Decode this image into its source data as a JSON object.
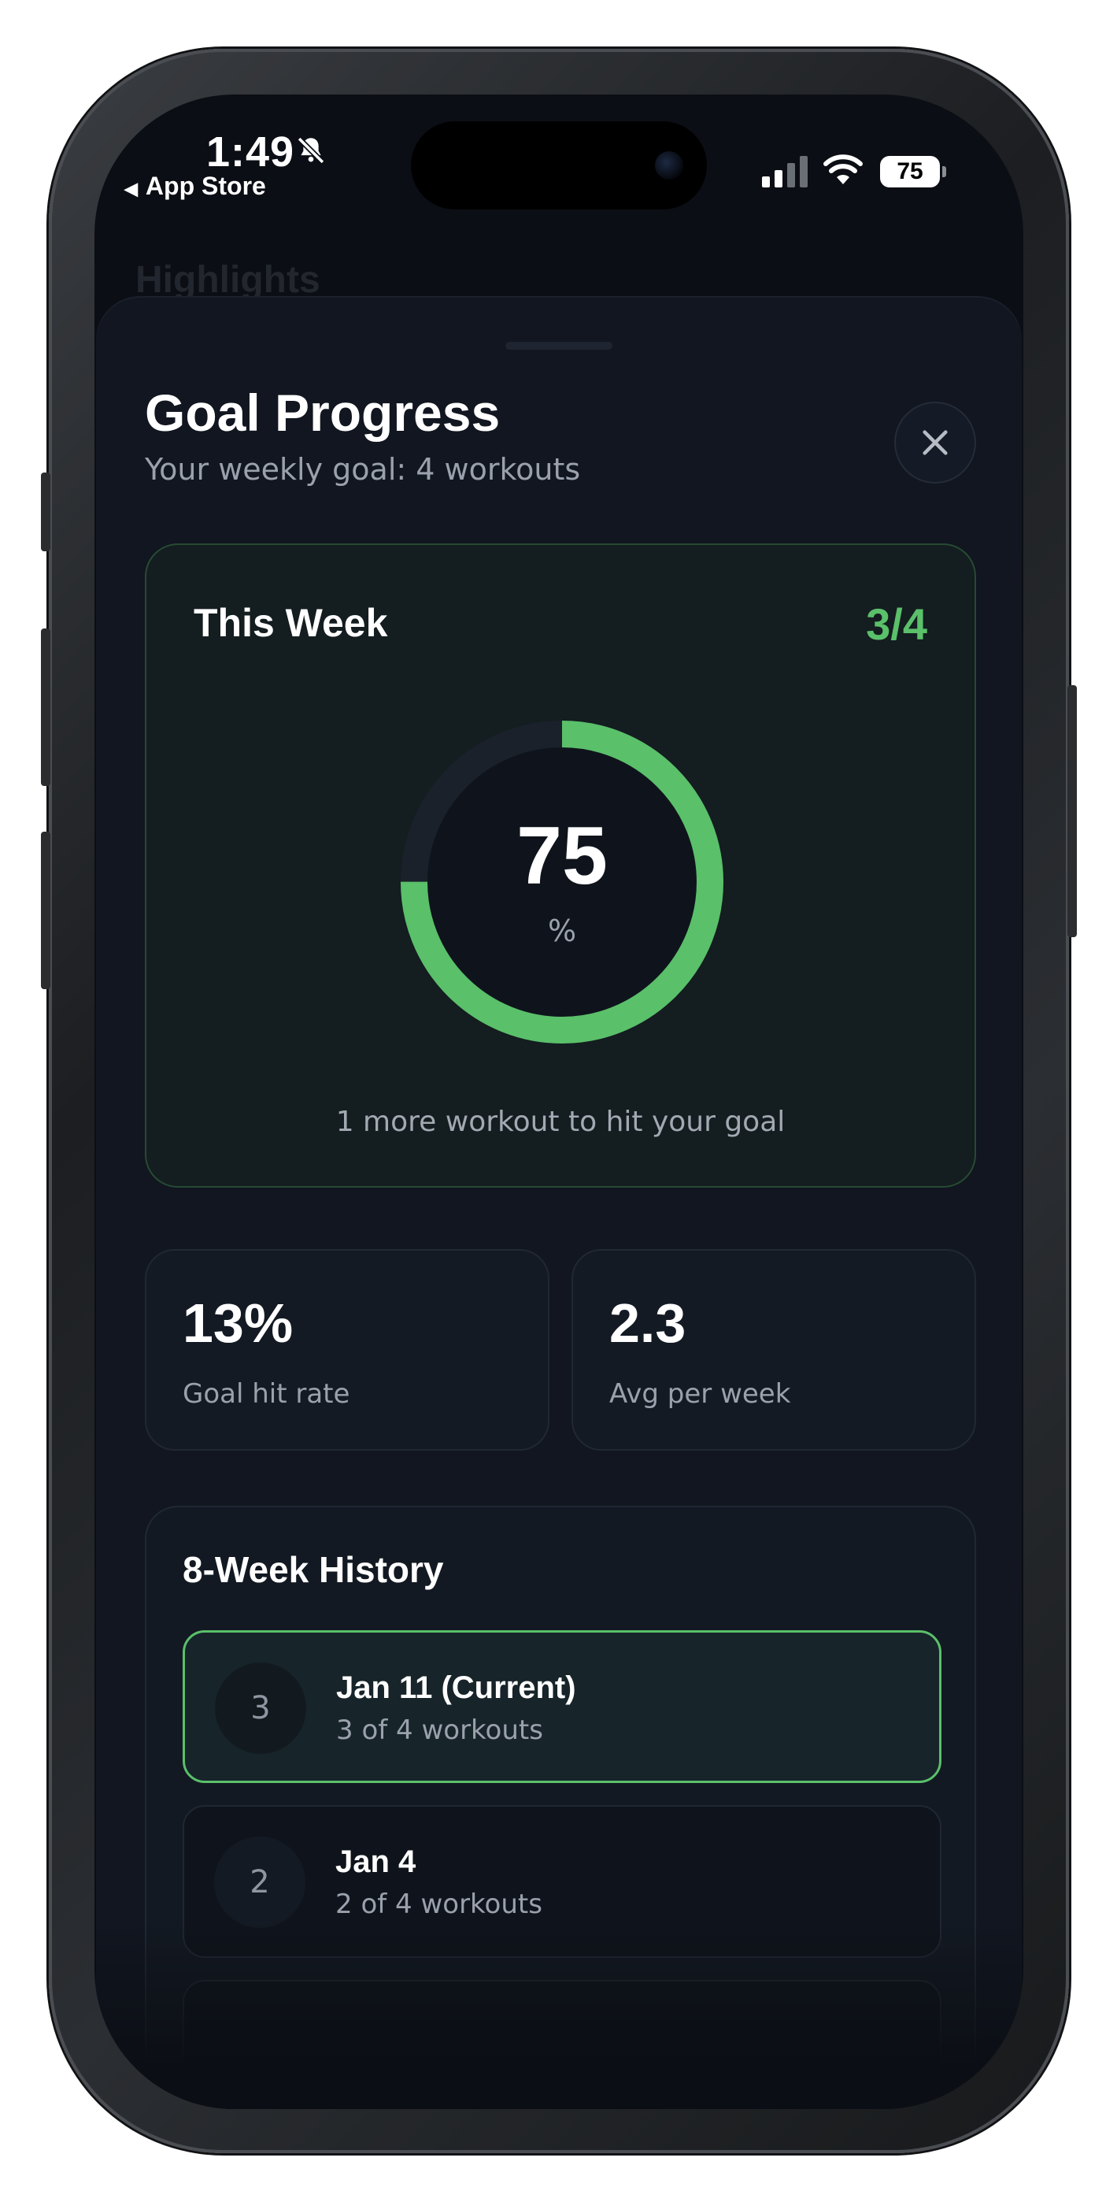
{
  "status_bar": {
    "time": "1:49",
    "back_label": "App Store",
    "battery": "75"
  },
  "background_title": "Highlights",
  "sheet": {
    "title": "Goal Progress",
    "subtitle": "Your weekly goal: 4 workouts"
  },
  "this_week": {
    "label": "This Week",
    "count": "3/4",
    "percent_value": "75",
    "percent_unit": "%",
    "progress": 0.75,
    "hint": "1 more workout to hit your goal"
  },
  "stats": [
    {
      "value": "13%",
      "label": "Goal hit rate"
    },
    {
      "value": "2.3",
      "label": "Avg per week"
    }
  ],
  "history": {
    "title": "8-Week History",
    "rows": [
      {
        "badge": "3",
        "title": "Jan 11 (Current)",
        "subtitle": "3 of 4 workouts",
        "current": true
      },
      {
        "badge": "2",
        "title": "Jan 4",
        "subtitle": "2 of 4 workouts",
        "current": false
      }
    ]
  },
  "colors": {
    "accent_green": "#5ac06a",
    "background": "#0b0e14",
    "sheet": "#111620"
  }
}
